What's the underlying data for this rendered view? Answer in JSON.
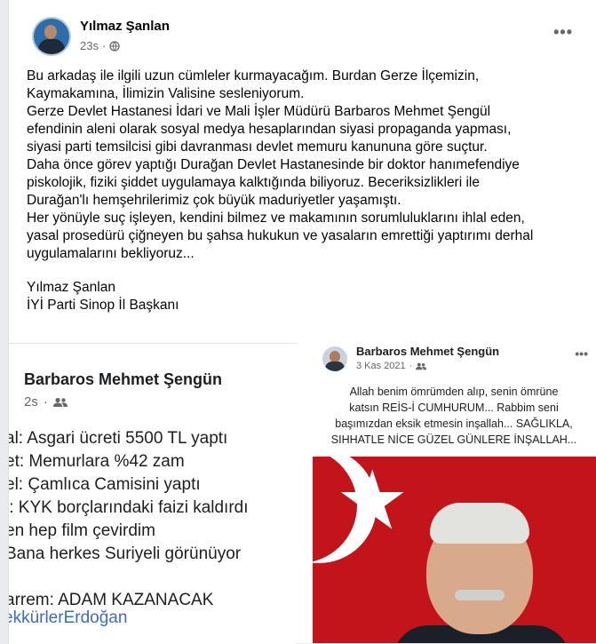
{
  "post": {
    "author": "Yılmaz Şanlan",
    "time": "23s",
    "privacy_icon": "globe-icon",
    "more_icon": "more-icon",
    "body_lines": [
      "Bu arkadaş ile ilgili uzun cümleler kurmayacağım. Burdan Gerze İlçemizin,",
      "Kaymakamına, İlimizin Valisine sesleniyorum.",
      "Gerze Devlet Hastanesi İdari ve Mali İşler Müdürü Barbaros Mehmet Şengül",
      "efendinin  aleni olarak sosyal medya hesaplarından siyasi propaganda yapması,",
      "siyasi parti temsilcisi gibi davranması devlet memuru kanununa göre suçtur.",
      "Daha önce görev yaptığı Durağan Devlet Hastanesinde bir doktor hanımefendiye",
      "piskolojik, fiziki şiddet uygulamaya kalktığında biliyoruz. Beceriksizlikleri ile",
      "Durağan'lı hemşehrilerimiz çok büyük maduriyetler yaşamıştı.",
      "Her yönüyle suç işleyen, kendini bilmez ve makamının sorumluluklarını ihlal eden,",
      "yasal prosedürü çiğneyen bu şahsa hukukun ve yasaların emrettiği yaptırımı derhal",
      "uygulamalarını bekliyoruz..."
    ],
    "signature_lines": [
      "Yılmaz Şanlan",
      "İYİ Parti Sinop İl Başkanı"
    ]
  },
  "left_screenshot": {
    "name": "Barbaros Mehmet Şengün",
    "time": "2s",
    "audience_icon": "friends-icon",
    "lines": [
      "al: Asgari ücreti 5500 TL yaptı",
      "et: Memurlara %42 zam",
      "el: Çamlıca Camisini yaptı",
      "l: KYK borçlarındaki faizi kaldırdı",
      "en hep film çevirdim",
      " Bana herkes Suriyeli görünüyor",
      "",
      "arrem: ADAM KAZANACAK"
    ],
    "hashtag": "ekkürlerErdoğan"
  },
  "right_screenshot": {
    "name": "Barbaros Mehmet Şengün",
    "date": "3 Kas 2021",
    "audience_icon": "friends-icon",
    "more_icon": "more-icon",
    "text_lines": [
      "Allah benim ömrümden alıp, senin ömrüne",
      "katsın REİS-İ CUMHURUM... Rabbim seni",
      "başımızdan eksik etmesin inşallah... SAĞLIKLA,",
      "SIHHATLE NİCE GÜZEL GÜNLERE İNŞALLAH..."
    ]
  }
}
